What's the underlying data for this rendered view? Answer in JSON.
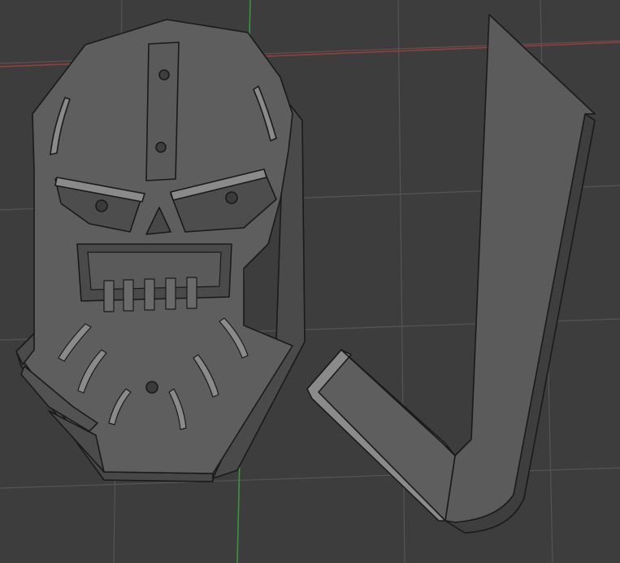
{
  "viewport": {
    "background_color": "#3d3d3d",
    "grid_color": "#555555",
    "x_axis_color": "#a33a3a",
    "y_axis_color": "#3a9a3a",
    "object_face_color": "#5e5e5e",
    "object_shade_color": "#4a4a4a",
    "object_highlight_color": "#8a8a8a",
    "edge_color": "#1a1a1a"
  },
  "objects": {
    "mask": {
      "name": "skull-mask-plate"
    },
    "hook": {
      "name": "hook-bracket"
    }
  }
}
